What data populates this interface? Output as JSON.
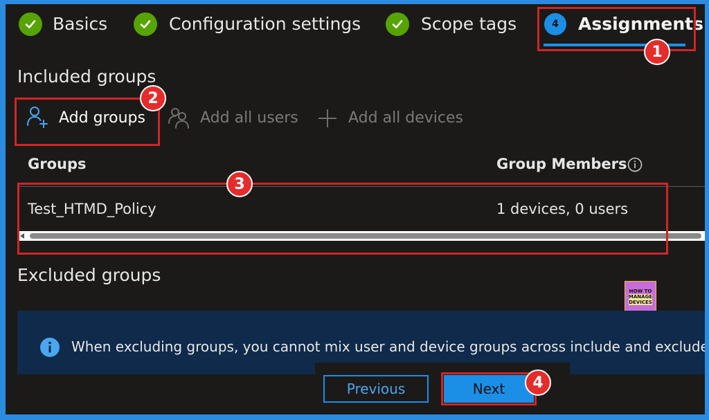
{
  "wizard": {
    "steps": [
      {
        "label": "Basics",
        "state": "complete"
      },
      {
        "label": "Configuration settings",
        "state": "complete"
      },
      {
        "label": "Scope tags",
        "state": "complete"
      },
      {
        "label": "Assignments",
        "state": "current",
        "number": "4"
      }
    ]
  },
  "included": {
    "title": "Included groups",
    "actions": {
      "add_groups": "Add groups",
      "add_all_users": "Add all users",
      "add_all_devices": "Add all devices"
    },
    "table": {
      "columns": [
        "Groups",
        "Group Members"
      ],
      "rows": [
        {
          "group": "Test_HTMD_Policy",
          "members": "1 devices, 0 users"
        }
      ]
    }
  },
  "excluded": {
    "title": "Excluded groups",
    "info": "When excluding groups, you cannot mix user and device groups across include and exclude"
  },
  "footer": {
    "previous": "Previous",
    "next": "Next"
  },
  "annotations": [
    "1",
    "2",
    "3",
    "4"
  ],
  "watermark": {
    "line1": "HOW TO",
    "line2": "MANAGE",
    "line3": "DEVICES"
  },
  "colors": {
    "accent": "#1b8fe6",
    "complete": "#57a300",
    "annotation": "#e62b2b",
    "background": "#1b1a19"
  }
}
